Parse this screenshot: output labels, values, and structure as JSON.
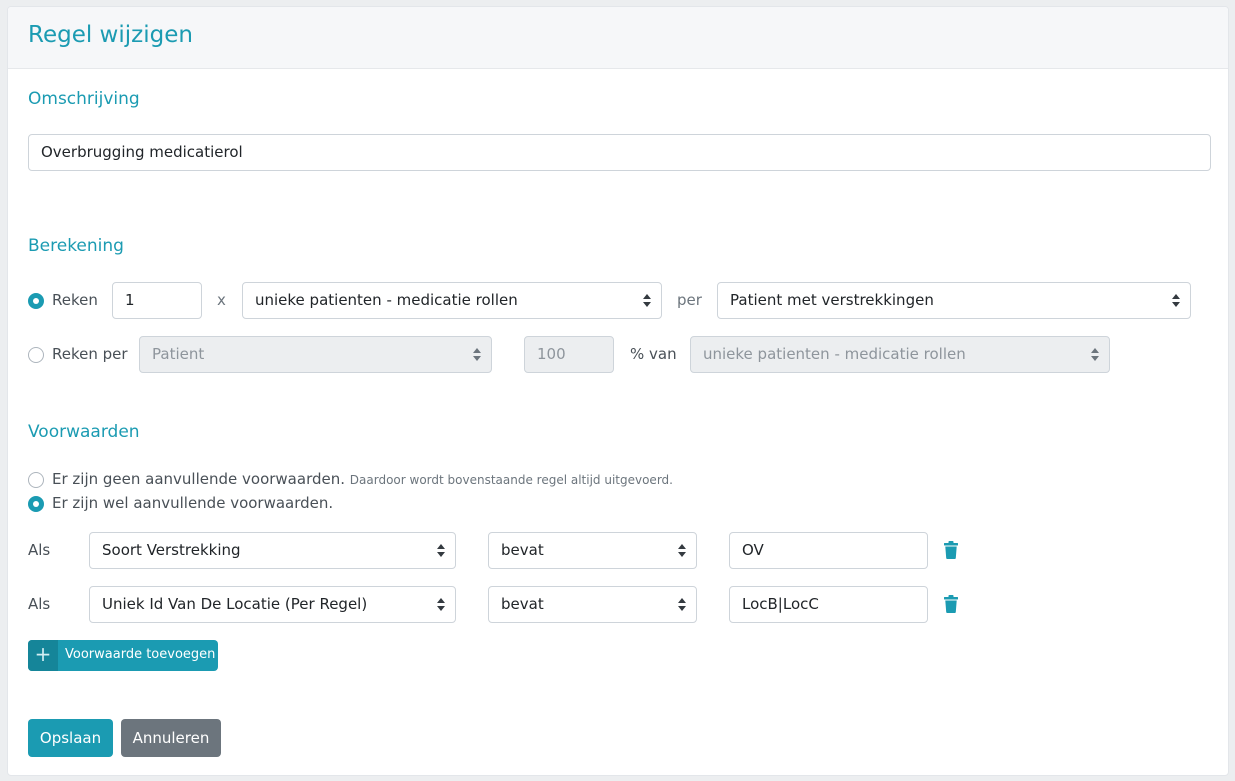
{
  "header": {
    "title": "Regel wijzigen"
  },
  "omschrijving": {
    "title": "Omschrijving",
    "value": "Overbrugging medicatierol"
  },
  "berekening": {
    "title": "Berekening",
    "row1": {
      "radio_label": "Reken",
      "checked": true,
      "amount": "1",
      "times": "x",
      "select1": "unieke patienten - medicatie rollen",
      "per": "per",
      "select2": "Patient met verstrekkingen"
    },
    "row2": {
      "radio_label": "Reken per",
      "checked": false,
      "select1": "Patient",
      "percentage": "100",
      "percent_label": "% van",
      "select2": "unieke patienten - medicatie rollen"
    }
  },
  "voorwaarden": {
    "title": "Voorwaarden",
    "option_none": {
      "label": "Er zijn geen aanvullende voorwaarden.",
      "hint": "Daardoor wordt bovenstaande regel altijd uitgevoerd.",
      "checked": false
    },
    "option_some": {
      "label": "Er zijn wel aanvullende voorwaarden.",
      "checked": true
    },
    "conditions": [
      {
        "als": "Als",
        "field": "Soort Verstrekking",
        "operator": "bevat",
        "value": "OV"
      },
      {
        "als": "Als",
        "field": "Uniek Id Van De Locatie (Per Regel)",
        "operator": "bevat",
        "value": "LocB|LocC"
      }
    ],
    "add_button": {
      "icon": "+",
      "label": "Voorwaarde toevoegen"
    }
  },
  "footer": {
    "save_label": "Opslaan",
    "cancel_label": "Annuleren"
  },
  "colors": {
    "accent": "#1b9bb2",
    "cancel": "#6c757d"
  },
  "icons": [
    "plus-icon",
    "trash-icon",
    "select-arrows-icon",
    "radio-icon"
  ]
}
